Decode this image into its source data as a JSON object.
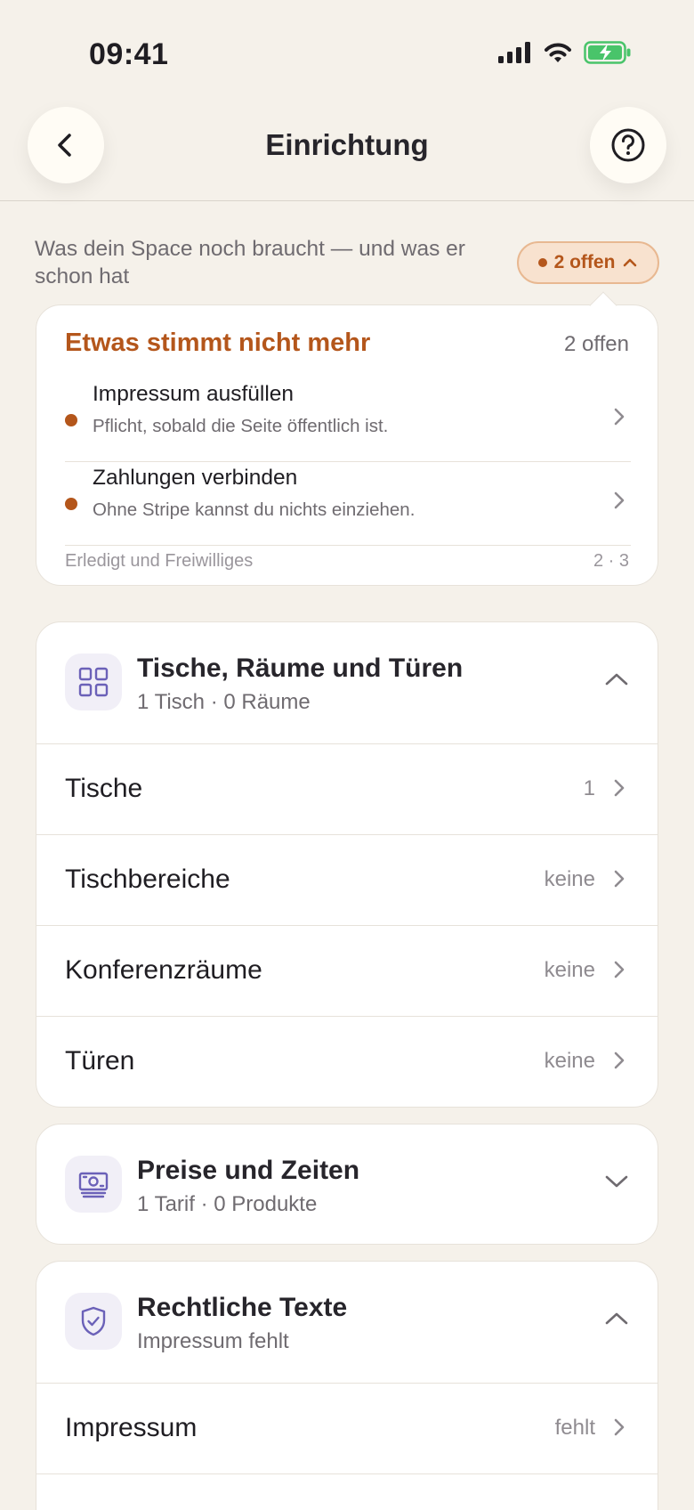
{
  "status_bar": {
    "time": "09:41",
    "icons": [
      "signal-icon",
      "wifi-icon",
      "battery-charging-icon"
    ]
  },
  "nav": {
    "title": "Einrichtung",
    "back_icon": "chevron-left-icon",
    "help_icon": "question-circle-icon"
  },
  "intro": {
    "text": "Was dein Space noch braucht — und was er schon hat",
    "open_badge": "2 offen"
  },
  "issues": {
    "title": "Etwas stimmt nicht mehr",
    "count": "2 offen",
    "items": [
      {
        "title": "Impressum ausfüllen",
        "subtitle": "Pflicht, sobald die Seite öffentlich ist."
      },
      {
        "title": "Zahlungen verbinden",
        "subtitle": "Ohne Stripe kannst du nichts einziehen."
      }
    ],
    "footer_label": "Erledigt und Freiwilliges",
    "footer_counts": "2 · 3"
  },
  "sections": {
    "tables": {
      "title": "Tische, Räume und Türen",
      "subtitle": "1 Tisch · 0 Räume",
      "expanded": true,
      "rows": [
        {
          "label": "Tische",
          "value": "1"
        },
        {
          "label": "Tischbereiche",
          "value": "keine"
        },
        {
          "label": "Konferenzräume",
          "value": "keine"
        },
        {
          "label": "Türen",
          "value": "keine"
        }
      ]
    },
    "prices": {
      "title": "Preise und Zeiten",
      "subtitle": "1 Tarif · 0 Produkte",
      "expanded": false
    },
    "legal": {
      "title": "Rechtliche Texte",
      "subtitle": "Impressum fehlt",
      "expanded": true,
      "rows": [
        {
          "label": "Impressum",
          "value": "fehlt"
        }
      ]
    }
  },
  "colors": {
    "background": "#f5f1ea",
    "accent": "#b4561b",
    "icon_tint": "#6b61b8",
    "badge_bg": "#f8e2cf"
  }
}
